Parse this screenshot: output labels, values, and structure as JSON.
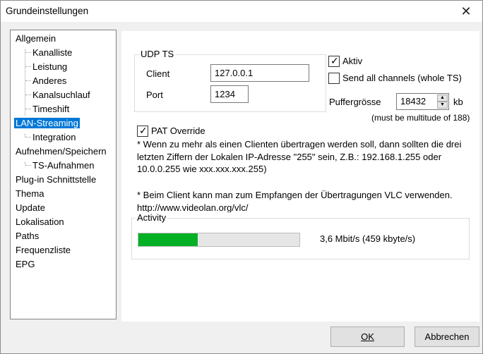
{
  "window": {
    "title": "Grundeinstellungen",
    "close_glyph": "✕"
  },
  "tree": {
    "items": [
      {
        "label": "Allgemein"
      },
      {
        "label": "Kanalliste"
      },
      {
        "label": "Leistung"
      },
      {
        "label": "Anderes"
      },
      {
        "label": "Kanalsuchlauf"
      },
      {
        "label": "Timeshift"
      },
      {
        "label": "LAN-Streaming"
      },
      {
        "label": "Integration"
      },
      {
        "label": "Aufnehmen/Speichern"
      },
      {
        "label": "TS-Aufnahmen"
      },
      {
        "label": "Plug-in Schnittstelle"
      },
      {
        "label": "Thema"
      },
      {
        "label": "Update"
      },
      {
        "label": "Lokalisation"
      },
      {
        "label": "Paths"
      },
      {
        "label": "Frequenzliste"
      },
      {
        "label": "EPG"
      }
    ],
    "selected": "LAN-Streaming"
  },
  "udp": {
    "group_label": "UDP TS",
    "client_label": "Client",
    "client_value": "127.0.0.1",
    "port_label": "Port",
    "port_value": "1234"
  },
  "options": {
    "aktiv_label": "Aktiv",
    "aktiv_checked": true,
    "send_all_label": "Send all channels (whole TS)",
    "send_all_checked": false,
    "puffer_label": "Puffergrösse",
    "puffer_value": "18432",
    "puffer_unit": "kb",
    "puffer_note": "(must be multitude of 188)"
  },
  "pat": {
    "label": "PAT Override",
    "checked": true,
    "note1": "* Wenn zu mehr als einen Clienten übertragen werden soll, dann sollten die drei letzten Ziffern der Lokalen IP-Adresse \"255\" sein, Z.B.: 192.168.1.255 oder 10.0.0.255 wie xxx.xxx.xxx.255)",
    "note2": "* Beim Client kann man zum Empfangen der Übertragungen VLC verwenden. http://www.videolan.org/vlc/"
  },
  "activity": {
    "group_label": "Activity",
    "rate_text": "3,6 Mbit/s  (459 kbyte/s)",
    "progress_fraction": 0.37,
    "progress_color": "#06b025"
  },
  "footer": {
    "ok_label": "OK",
    "cancel_label": "Abbrechen"
  }
}
